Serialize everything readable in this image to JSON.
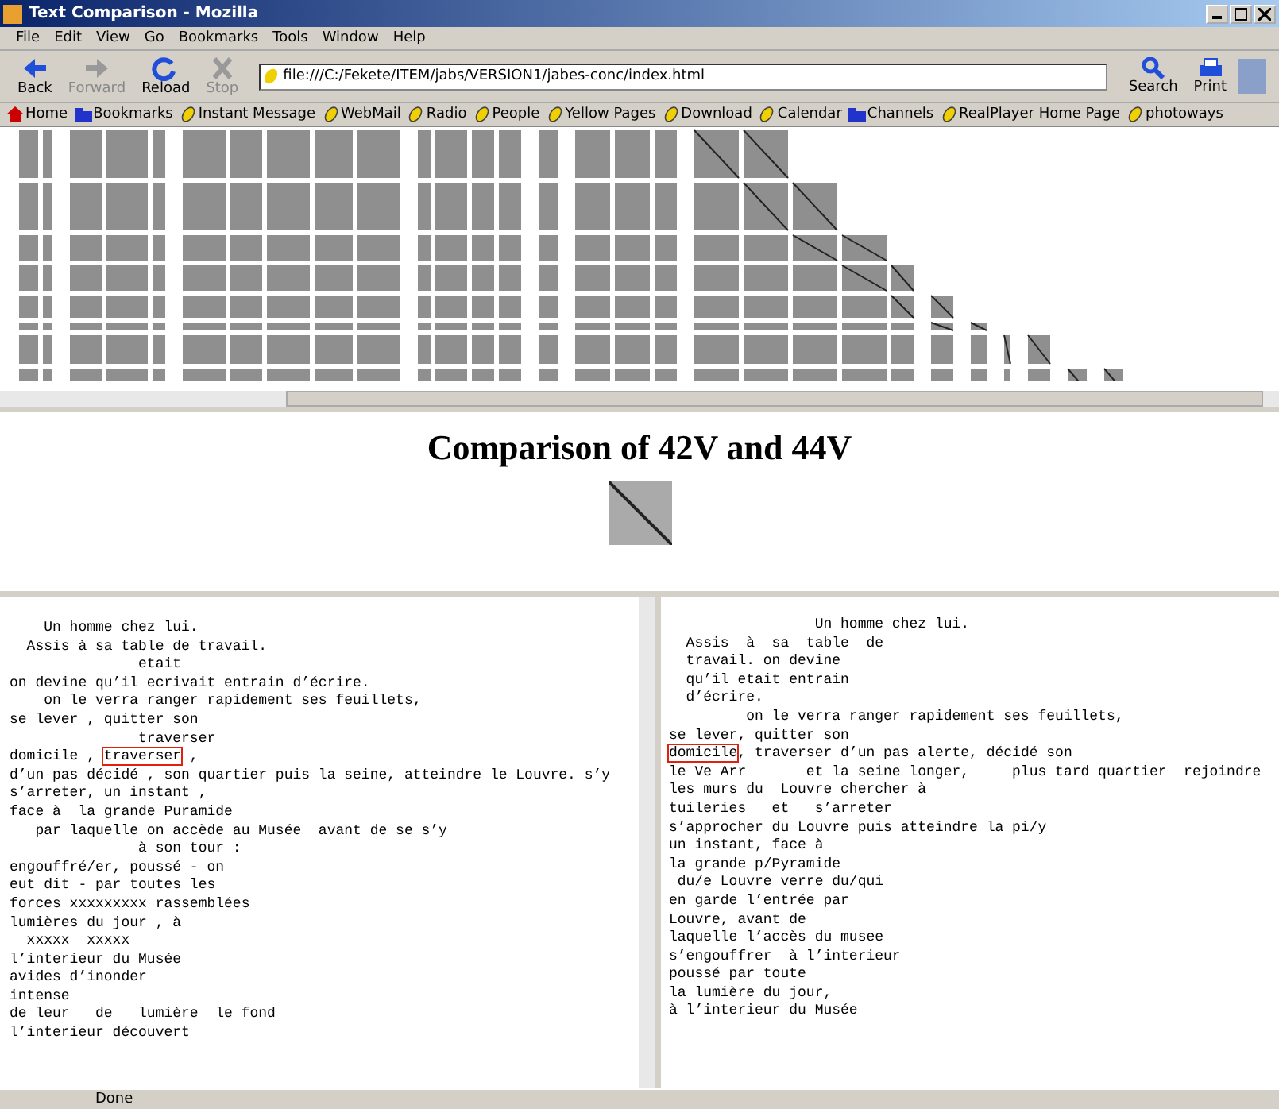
{
  "window": {
    "title": "Text Comparison - Mozilla"
  },
  "menu": [
    "File",
    "Edit",
    "View",
    "Go",
    "Bookmarks",
    "Tools",
    "Window",
    "Help"
  ],
  "nav_buttons": [
    {
      "label": "Back",
      "kind": "back",
      "disabled": false
    },
    {
      "label": "Forward",
      "kind": "forward",
      "disabled": true
    },
    {
      "label": "Reload",
      "kind": "reload",
      "disabled": false
    },
    {
      "label": "Stop",
      "kind": "stop",
      "disabled": true
    }
  ],
  "address": {
    "value": "file:///C:/Fekete/ITEM/jabs/VERSION1/jabes-conc/index.html"
  },
  "tool_buttons": [
    {
      "label": "Search",
      "kind": "search"
    },
    {
      "label": "Print",
      "kind": "print"
    }
  ],
  "bookmarks": [
    {
      "label": "Home",
      "kind": "home"
    },
    {
      "label": "Bookmarks",
      "kind": "folder"
    },
    {
      "label": "Instant Message",
      "kind": "link"
    },
    {
      "label": "WebMail",
      "kind": "link"
    },
    {
      "label": "Radio",
      "kind": "link"
    },
    {
      "label": "People",
      "kind": "link"
    },
    {
      "label": "Yellow Pages",
      "kind": "link"
    },
    {
      "label": "Download",
      "kind": "link"
    },
    {
      "label": "Calendar",
      "kind": "link"
    },
    {
      "label": "Channels",
      "kind": "folder"
    },
    {
      "label": "RealPlayer Home Page",
      "kind": "link"
    },
    {
      "label": "photoways",
      "kind": "link"
    }
  ],
  "heading": "Comparison of 42V and 44V",
  "left_text": [
    {
      "text": "    Un homme chez lui."
    },
    {
      "text": "  Assis à sa table de travail."
    },
    {
      "text": "               etait"
    },
    {
      "text": "on devine qu’il ecrivait entrain d’écrire."
    },
    {
      "text": "    on le verra ranger rapidement ses feuillets,"
    },
    {
      "text": "se lever , quitter son"
    },
    {
      "text": "               traverser"
    },
    {
      "text": "domicile , ",
      "marked": "traverser",
      "after": " ,"
    },
    {
      "text": "d’un pas décidé , son quartier puis la seine, atteindre le Louvre. s’y"
    },
    {
      "text": "s’arreter, un instant ,"
    },
    {
      "text": "face à  la grande Puramide"
    },
    {
      "text": "   par laquelle on accède au Musée  avant de se s’y"
    },
    {
      "text": "               à son tour :"
    },
    {
      "text": "engouffré/er, poussé - on"
    },
    {
      "text": "eut dit - par toutes les"
    },
    {
      "text": "forces xxxxxxxxx rassemblées"
    },
    {
      "text": "lumières du jour , à"
    },
    {
      "text": "  xxxxx  xxxxx"
    },
    {
      "text": "l’interieur du Musée"
    },
    {
      "text": "avides d’inonder"
    },
    {
      "text": "intense"
    },
    {
      "text": "de leur   de   lumière  le fond"
    },
    {
      "text": "l’interieur découvert"
    }
  ],
  "right_text": [
    {
      "text": "                 Un homme chez lui."
    },
    {
      "text": "  Assis  à  sa  table  de"
    },
    {
      "text": "  travail. on devine"
    },
    {
      "text": "  qu’il etait entrain"
    },
    {
      "text": "  d’écrire."
    },
    {
      "text": "         on le verra ranger rapidement ses feuillets,"
    },
    {
      "text": "se lever, quitter son"
    },
    {
      "marked": "domicile",
      "after": ", traverser d’un pas alerte, décidé son"
    },
    {
      "text": "le Ve Arr       et la seine longer,     plus tard quartier  rejoindre"
    },
    {
      "text": "les murs du  Louvre chercher à"
    },
    {
      "text": "tuileries   et   s’arreter"
    },
    {
      "text": "s’approcher du Louvre puis atteindre la pi/y"
    },
    {
      "text": "un instant, face à"
    },
    {
      "text": "la grande p/Pyramide"
    },
    {
      "text": " du/e Louvre verre du/qui"
    },
    {
      "text": "en garde l’entrée par"
    },
    {
      "text": "Louvre, avant de"
    },
    {
      "text": "laquelle l’accès du musee"
    },
    {
      "text": "s’engouffrer  à l’interieur"
    },
    {
      "text": "poussé par toute"
    },
    {
      "text": "la lumière du jour,"
    },
    {
      "text": "à l’interieur du Musée"
    }
  ],
  "status_bar": {
    "text": "Done"
  }
}
